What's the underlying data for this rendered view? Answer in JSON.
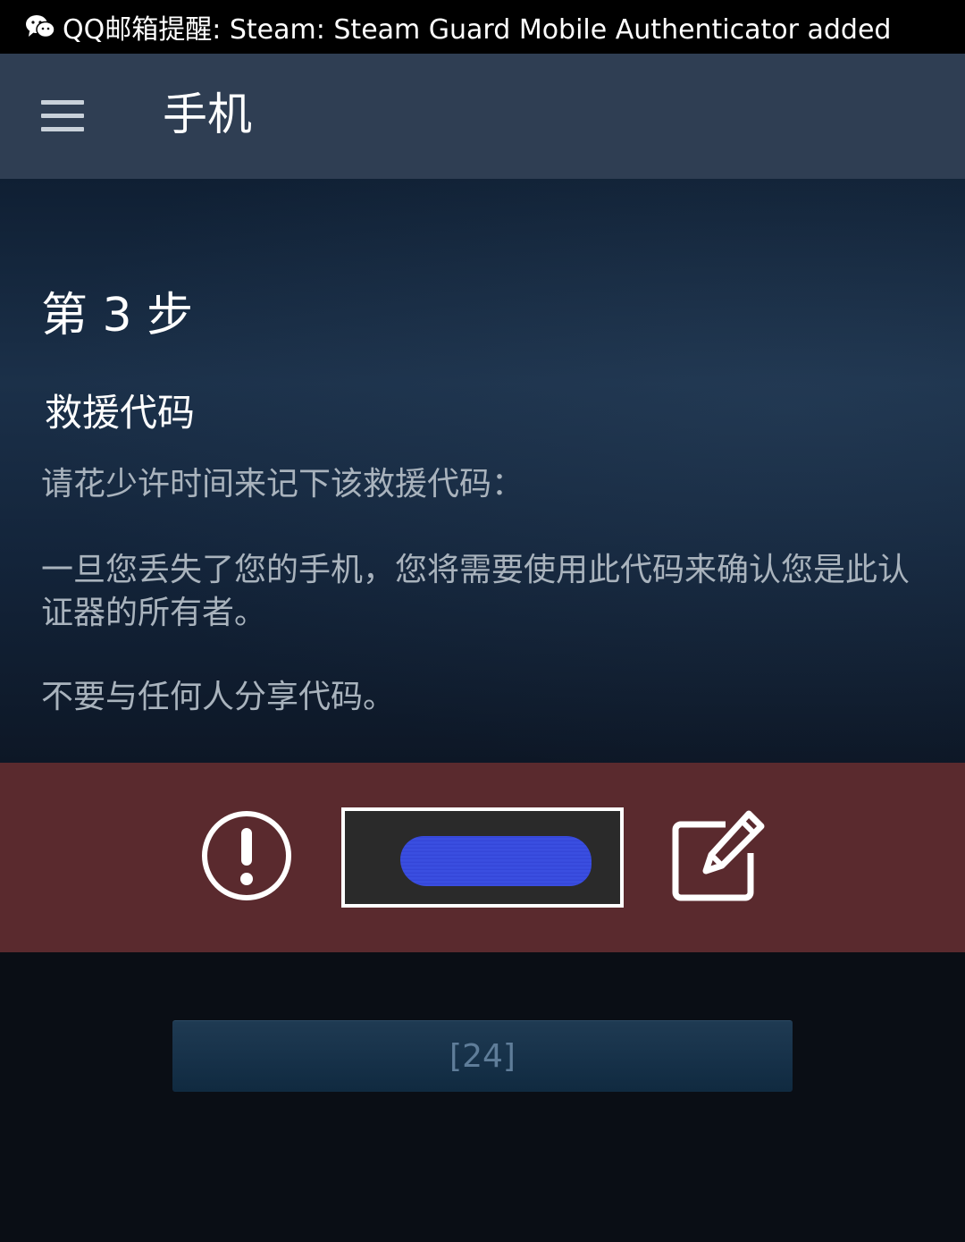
{
  "notification": {
    "icon": "wechat-icon",
    "text": "QQ邮箱提醒: Steam: Steam Guard Mobile Authenticator added"
  },
  "appbar": {
    "menu_icon": "hamburger-menu-icon",
    "title": "手机"
  },
  "content": {
    "step_title": "第 3 步",
    "section_title": "救援代码",
    "paragraph_1": "请花少许时间来记下该救援代码：",
    "paragraph_2": "一旦您丢失了您的手机，您将需要使用此代码来确认您是此认证器的所有者。",
    "paragraph_3": "不要与任何人分享代码。"
  },
  "code_band": {
    "warning_icon": "exclamation-circle-icon",
    "code_value": "",
    "code_redacted": true,
    "edit_icon": "edit-pencil-icon"
  },
  "footer": {
    "button_label": "[24]"
  },
  "colors": {
    "notification_bg": "#000000",
    "appbar_bg": "#2f3e53",
    "code_band_bg": "#5a2a2e",
    "redaction_color": "#3a4ee0",
    "button_text": "#5f7d99"
  }
}
